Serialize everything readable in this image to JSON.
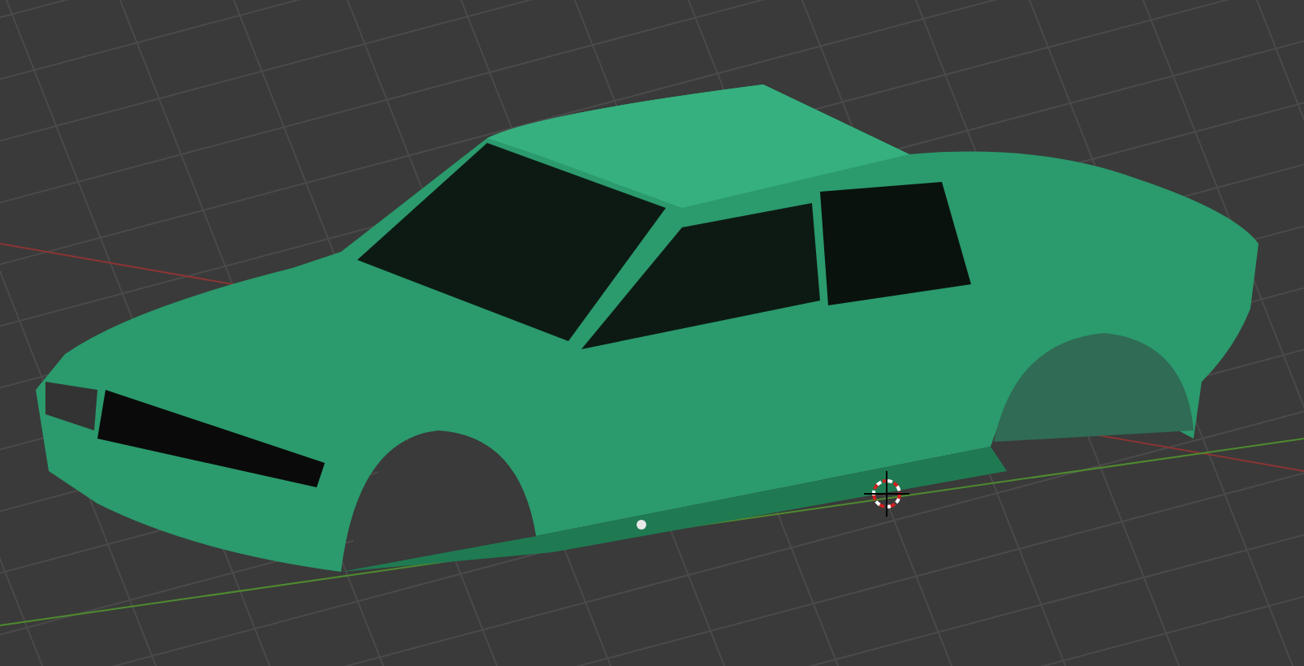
{
  "viewport": {
    "grid_visible": true,
    "cursor_visible": true,
    "origin_visible": true
  }
}
